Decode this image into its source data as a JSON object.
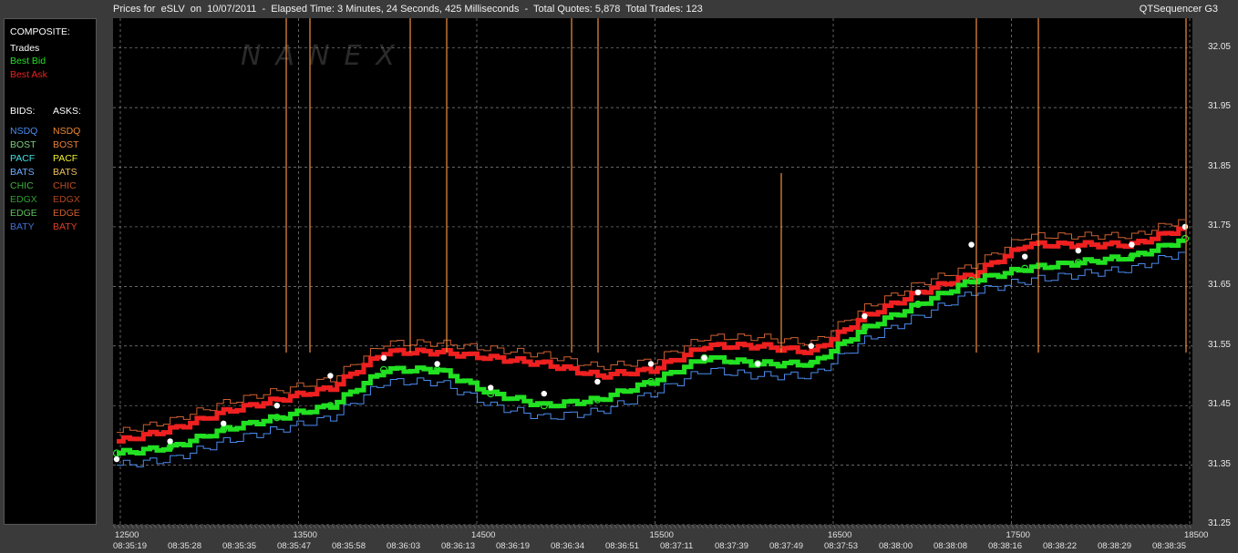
{
  "header": {
    "title": "Prices for  eSLV  on  10/07/2011  -  Elapsed Time: 3 Minutes, 24 Seconds, 425 Milliseconds  -  Total Quotes: 5,878  Total Trades: 123",
    "app_name": "QTSequencer G3"
  },
  "watermark": "NANEX",
  "legend": {
    "composite_heading": "COMPOSITE:",
    "composite_items": [
      {
        "label": "Trades",
        "color": "#ffffff"
      },
      {
        "label": "Best Bid",
        "color": "#22e022"
      },
      {
        "label": "Best Ask",
        "color": "#ee2020"
      }
    ],
    "bids_heading": "BIDS:",
    "asks_heading": "ASKS:",
    "exchanges": [
      {
        "bid": "NSDQ",
        "bid_color": "#4a8cf0",
        "ask": "NSDQ",
        "ask_color": "#f08a30"
      },
      {
        "bid": "BOST",
        "bid_color": "#7ad07a",
        "ask": "BOST",
        "ask_color": "#e8803a"
      },
      {
        "bid": "PACF",
        "bid_color": "#40e0e0",
        "ask": "PACF",
        "ask_color": "#f0f030"
      },
      {
        "bid": "BATS",
        "bid_color": "#70b0ff",
        "ask": "BATS",
        "ask_color": "#f0c060"
      },
      {
        "bid": "CHIC",
        "bid_color": "#40b040",
        "ask": "CHIC",
        "ask_color": "#c05020"
      },
      {
        "bid": "EDGX",
        "bid_color": "#30a030",
        "ask": "EDGX",
        "ask_color": "#b04820"
      },
      {
        "bid": "EDGE",
        "bid_color": "#60c060",
        "ask": "EDGE",
        "ask_color": "#d06030"
      },
      {
        "bid": "BATY",
        "bid_color": "#4070d0",
        "ask": "BATY",
        "ask_color": "#e04020"
      }
    ]
  },
  "chart_data": {
    "type": "line",
    "ylim": [
      31.25,
      32.1
    ],
    "y_ticks": [
      "32.05",
      "31.95",
      "31.85",
      "31.75",
      "31.65",
      "31.55",
      "31.45",
      "31.35",
      "31.25"
    ],
    "x_count_ticks": [
      "12500",
      "13500",
      "14500",
      "15500",
      "16500",
      "17500",
      "18500"
    ],
    "x_time_ticks": [
      "08:35:19",
      "08:35:28",
      "08:35:35",
      "08:35:47",
      "08:35:58",
      "08:36:03",
      "08:36:13",
      "08:36:19",
      "08:36:34",
      "08:36:51",
      "08:37:11",
      "08:37:39",
      "08:37:49",
      "08:37:53",
      "08:38:00",
      "08:38:08",
      "08:38:16",
      "08:38:22",
      "08:38:29",
      "08:38:35"
    ],
    "x": [
      0,
      5,
      10,
      15,
      20,
      25,
      30,
      35,
      40,
      45,
      50,
      55,
      60,
      65,
      70,
      75,
      80,
      85,
      90,
      95,
      100
    ],
    "series": [
      {
        "name": "Best Ask",
        "color": "#ee2020",
        "values": [
          31.39,
          31.41,
          31.44,
          31.46,
          31.48,
          31.54,
          31.54,
          31.53,
          31.52,
          31.5,
          31.51,
          31.55,
          31.55,
          31.54,
          31.6,
          31.64,
          31.67,
          31.72,
          31.72,
          31.72,
          31.75
        ]
      },
      {
        "name": "Best Bid",
        "color": "#22e022",
        "values": [
          31.37,
          31.38,
          31.41,
          31.43,
          31.45,
          31.51,
          31.51,
          31.47,
          31.45,
          31.46,
          31.49,
          31.53,
          31.52,
          31.52,
          31.58,
          31.62,
          31.66,
          31.68,
          31.69,
          31.7,
          31.73
        ]
      },
      {
        "name": "Trades",
        "color": "#ffffff",
        "values": [
          31.36,
          31.39,
          31.42,
          31.45,
          31.5,
          31.53,
          31.52,
          31.48,
          31.47,
          31.49,
          31.52,
          31.53,
          31.52,
          31.55,
          31.6,
          31.64,
          31.72,
          31.7,
          31.71,
          31.72,
          31.75
        ]
      }
    ]
  }
}
